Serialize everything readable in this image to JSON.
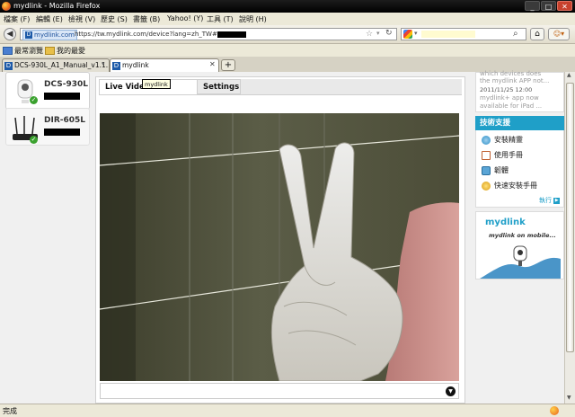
{
  "window": {
    "title": "mydlink - Mozilla Firefox",
    "controls": [
      "_",
      "□",
      "✕"
    ]
  },
  "menu": [
    "檔案 (F)",
    "編輯 (E)",
    "檢視 (V)",
    "歷史 (S)",
    "書籤 (B)",
    "Yahoo! (Y)",
    "工具 (T)",
    "說明 (H)"
  ],
  "nav": {
    "site_label": "mydlink.com",
    "url": "https://tw.mydlink.com/device?lang=zh_TW#"
  },
  "bookmarks": [
    "最常瀏覽",
    "我的最愛"
  ],
  "tabs": [
    {
      "label": "DCS-930L_A1_Manual_v1.1..."
    },
    {
      "label": "mydlink"
    }
  ],
  "devices": [
    {
      "name": "DCS-930L",
      "status": "online"
    },
    {
      "name": "DIR-605L",
      "status": "online"
    }
  ],
  "panel": {
    "tab_live": "Live Video",
    "tab_settings": "Settings",
    "tooltip": "mydlink"
  },
  "news": {
    "line1": "which devices does",
    "line2": "the mydlink APP not...",
    "date": "2011/11/25 12:00",
    "line3": "mydlink+ app now",
    "line4": "available for iPad ..."
  },
  "support": {
    "title": "技術支援",
    "items": [
      "安裝精靈",
      "使用手冊",
      "韌體",
      "快速安裝手冊"
    ],
    "more": "執行"
  },
  "promo": {
    "logo": "mydlink",
    "tagline": "mydlink on mobile..."
  },
  "status": {
    "text": "完成"
  },
  "colors": {
    "accent": "#1f9fc8",
    "online": "#3aa12e",
    "dlink_blue": "#1d5aa8"
  }
}
